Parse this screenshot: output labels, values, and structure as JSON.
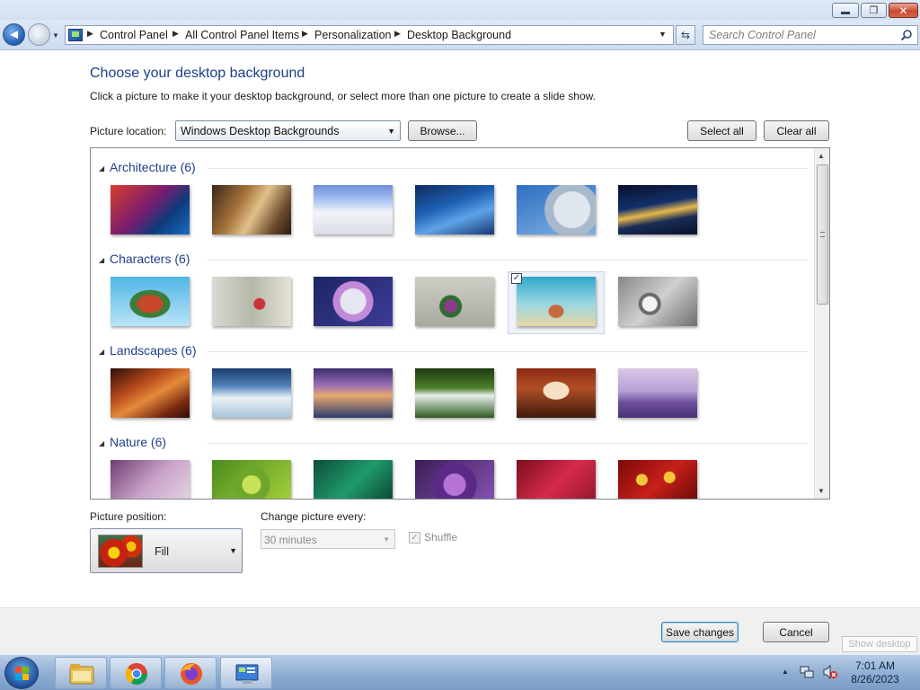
{
  "window": {
    "minimize": "",
    "maximize": "",
    "close": "✕"
  },
  "nav": {
    "breadcrumbs": [
      "Control Panel",
      "All Control Panel Items",
      "Personalization",
      "Desktop Background"
    ],
    "search_placeholder": "Search Control Panel"
  },
  "page": {
    "heading": "Choose your desktop background",
    "subtext": "Click a picture to make it your desktop background, or select more than one picture to create a slide show.",
    "location_label": "Picture location:",
    "location_value": "Windows Desktop Backgrounds",
    "browse_label": "Browse...",
    "select_all_label": "Select all",
    "clear_all_label": "Clear all"
  },
  "groups": [
    {
      "title": "Architecture (6)",
      "thumbs": [
        "linear-gradient(135deg,#d8402a 0%,#7a1c6e 45%,#0e3b7c 70%,#1b6dc1 100%)",
        "linear-gradient(120deg,#3b2718 0%,#a5723a 35%,#e2c08b 55%,#6b4a2b 80%,#2a1b10 100%)",
        "linear-gradient(180deg,#6d8fd9 0%,#a9c2f2 30%,#f2f4f8 55%,#d9dde6 100%)",
        "linear-gradient(160deg,#0f2b5c 0%,#1e5fb3 40%,#5ea3e8 65%,#15386e 100%)",
        "radial-gradient(circle at 70% 50%,#dfe6ee 0 20px,#a8b9cc 21px 30px,transparent 31px),linear-gradient(160deg,#2e6fc0,#7fb0e5)",
        "linear-gradient(170deg,#08102a 0%,#13306b 40%,#e6b94a 55%,#1a2d57 70%,#07102a 100%)"
      ],
      "selected": -1
    },
    {
      "title": "Characters (6)",
      "thumbs": [
        "radial-gradient(ellipse at 50% 55%,#c8462a 0 14px,#3d7c3a 15px 22px,transparent 23px),linear-gradient(180deg,#4fb6e6,#b9e4f6)",
        "radial-gradient(circle at 60% 55%,#c9343a 0 6px,transparent 7px),linear-gradient(90deg,#d9dad2,#b4b9a8 50%,#e5e2d6)",
        "radial-gradient(circle at 50% 50%,#e6e6f0 0 14px,#c18ad8 15px 22px,transparent 23px),linear-gradient(135deg,#1c2563,#3e3c9a)",
        "radial-gradient(circle at 45% 60%,#8c3b8a 0 7px,#2c6f2c 8px 12px,transparent 13px),linear-gradient(180deg,#cfcfc8,#a9a99e)",
        "radial-gradient(ellipse at 50% 70%,#c46b3e 0 8px,transparent 9px),linear-gradient(180deg,#2fa8c9 0%,#9ad7e3 55%,#e8d7a5 100%)",
        "radial-gradient(circle at 40% 55%,#f2f2f2 0 8px,#6a6a6a 9px 12px,transparent 13px),linear-gradient(135deg,#888,#cfcfcf 50%,#6e6e6e)"
      ],
      "selected": 4
    },
    {
      "title": "Landscapes (6)",
      "thumbs": [
        "linear-gradient(150deg,#2a0e08 0%,#b84a1c 35%,#e58a3a 55%,#7a2a12 80%,#2e0c06 100%)",
        "linear-gradient(180deg,#1d3d6e 0%,#4e7fb7 35%,#e9f1f7 60%,#a9c3da 100%)",
        "linear-gradient(180deg,#3a2e6e 0%,#9d6fb4 35%,#e6a86f 55%,#2c3b6b 100%)",
        "linear-gradient(180deg,#1d3a12 0%,#4d7f2a 40%,#e9f0ee 55%,#2f5a1d 100%)",
        "radial-gradient(ellipse at 50% 45%,#f5e0c4 0 14px,transparent 15px),linear-gradient(180deg,#8b2a12 0%,#b24f26 40%,#3d1a0c 100%)",
        "linear-gradient(180deg,#d9c6e6 0%,#b9a0d8 45%,#6c4e9b 70%,#4b3075 100%)"
      ],
      "selected": -1
    },
    {
      "title": "Nature (6)",
      "thumbs": [
        "linear-gradient(135deg,#6f3e72,#c9a3c9 50%,#e7dbe5)",
        "radial-gradient(circle at 50% 50%,#c8e35a 0 10px,#6da62a 11px 20px,transparent 21px),linear-gradient(135deg,#4c8c1e,#a8d43c)",
        "linear-gradient(135deg,#0d4f3a,#1f9a6a 50%,#0a3b2c)",
        "radial-gradient(circle at 50% 50%,#b673d8 0 12px,#5b2a86 13px 24px,transparent 25px),linear-gradient(135deg,#3a1d56,#8c55b8)",
        "linear-gradient(135deg,#7a0e1e,#d62a4a 50%,#8c1428)",
        "radial-gradient(circle at 30% 40%,#f2c83a 0 6px,transparent 7px),radial-gradient(circle at 65% 35%,#f2c83a 0 6px,transparent 7px),linear-gradient(135deg,#7a0a0a,#c8201a 50%,#5a0606)"
      ],
      "selected": -1
    }
  ],
  "options": {
    "position_label": "Picture position:",
    "position_value": "Fill",
    "change_label": "Change picture every:",
    "interval_value": "30 minutes",
    "shuffle_label": "Shuffle"
  },
  "footer": {
    "save_label": "Save changes",
    "cancel_label": "Cancel",
    "show_desktop": "Show desktop"
  },
  "taskbar": {
    "time": "7:01 AM",
    "date": "8/26/2023"
  }
}
